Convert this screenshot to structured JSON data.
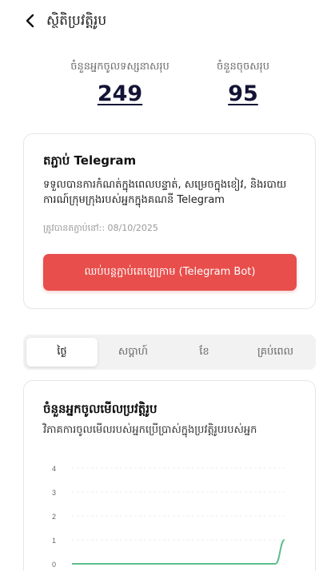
{
  "header": {
    "title": "ស្ថិតិប្រវត្តិរូប",
    "back_icon": "chevron-left-icon"
  },
  "stats": [
    {
      "label": "ចំនួនអ្នកចូលទស្សនាសរុប",
      "value": "249"
    },
    {
      "label": "ចំនួនចុចសរុប",
      "value": "95"
    }
  ],
  "telegram": {
    "title": "តភ្ជាប់ Telegram",
    "description": "ទទួលបានការកំណត់ក្នុងពេលបន្ទាត់, សម្រេចក្នុងខៀវ, និងរបាយការណ៍ក្រុមក្រុងរបស់អ្នកក្នុងគណនី Telegram",
    "connected_at": "ត្រូវបានតភ្ជាប់នៅ:: 08/10/2025",
    "disconnect_label": "ឈប់បន្តភ្ជាប់តេឡេក្រាម (Telegram Bot)",
    "accent": "#e84e4b"
  },
  "tabs": [
    {
      "label": "ថ្ងៃ",
      "active": true
    },
    {
      "label": "សប្តាហ៍",
      "active": false
    },
    {
      "label": "ខែ",
      "active": false
    },
    {
      "label": "គ្រប់ពេល",
      "active": false
    }
  ],
  "chart_card": {
    "title": "ចំនួនអ្នកចូលមើលប្រវត្តិរូប",
    "subtitle": "វិភាគការចូលមើលរបស់អ្នកប្រើប្រាស់ក្នុងប្រវត្តិរូបរបស់អ្នក"
  },
  "chart_data": {
    "type": "line",
    "ylim": [
      0,
      4
    ],
    "yticks": [
      "4",
      "3",
      "2",
      "1",
      "0"
    ],
    "grid": true,
    "series": [
      {
        "values": [
          0,
          0,
          0,
          0,
          0,
          0,
          0,
          0,
          0,
          0,
          0,
          0,
          0,
          0,
          0,
          0,
          0,
          0,
          0,
          0,
          0,
          0,
          0,
          1
        ],
        "color": "#5cbf8a"
      }
    ]
  }
}
